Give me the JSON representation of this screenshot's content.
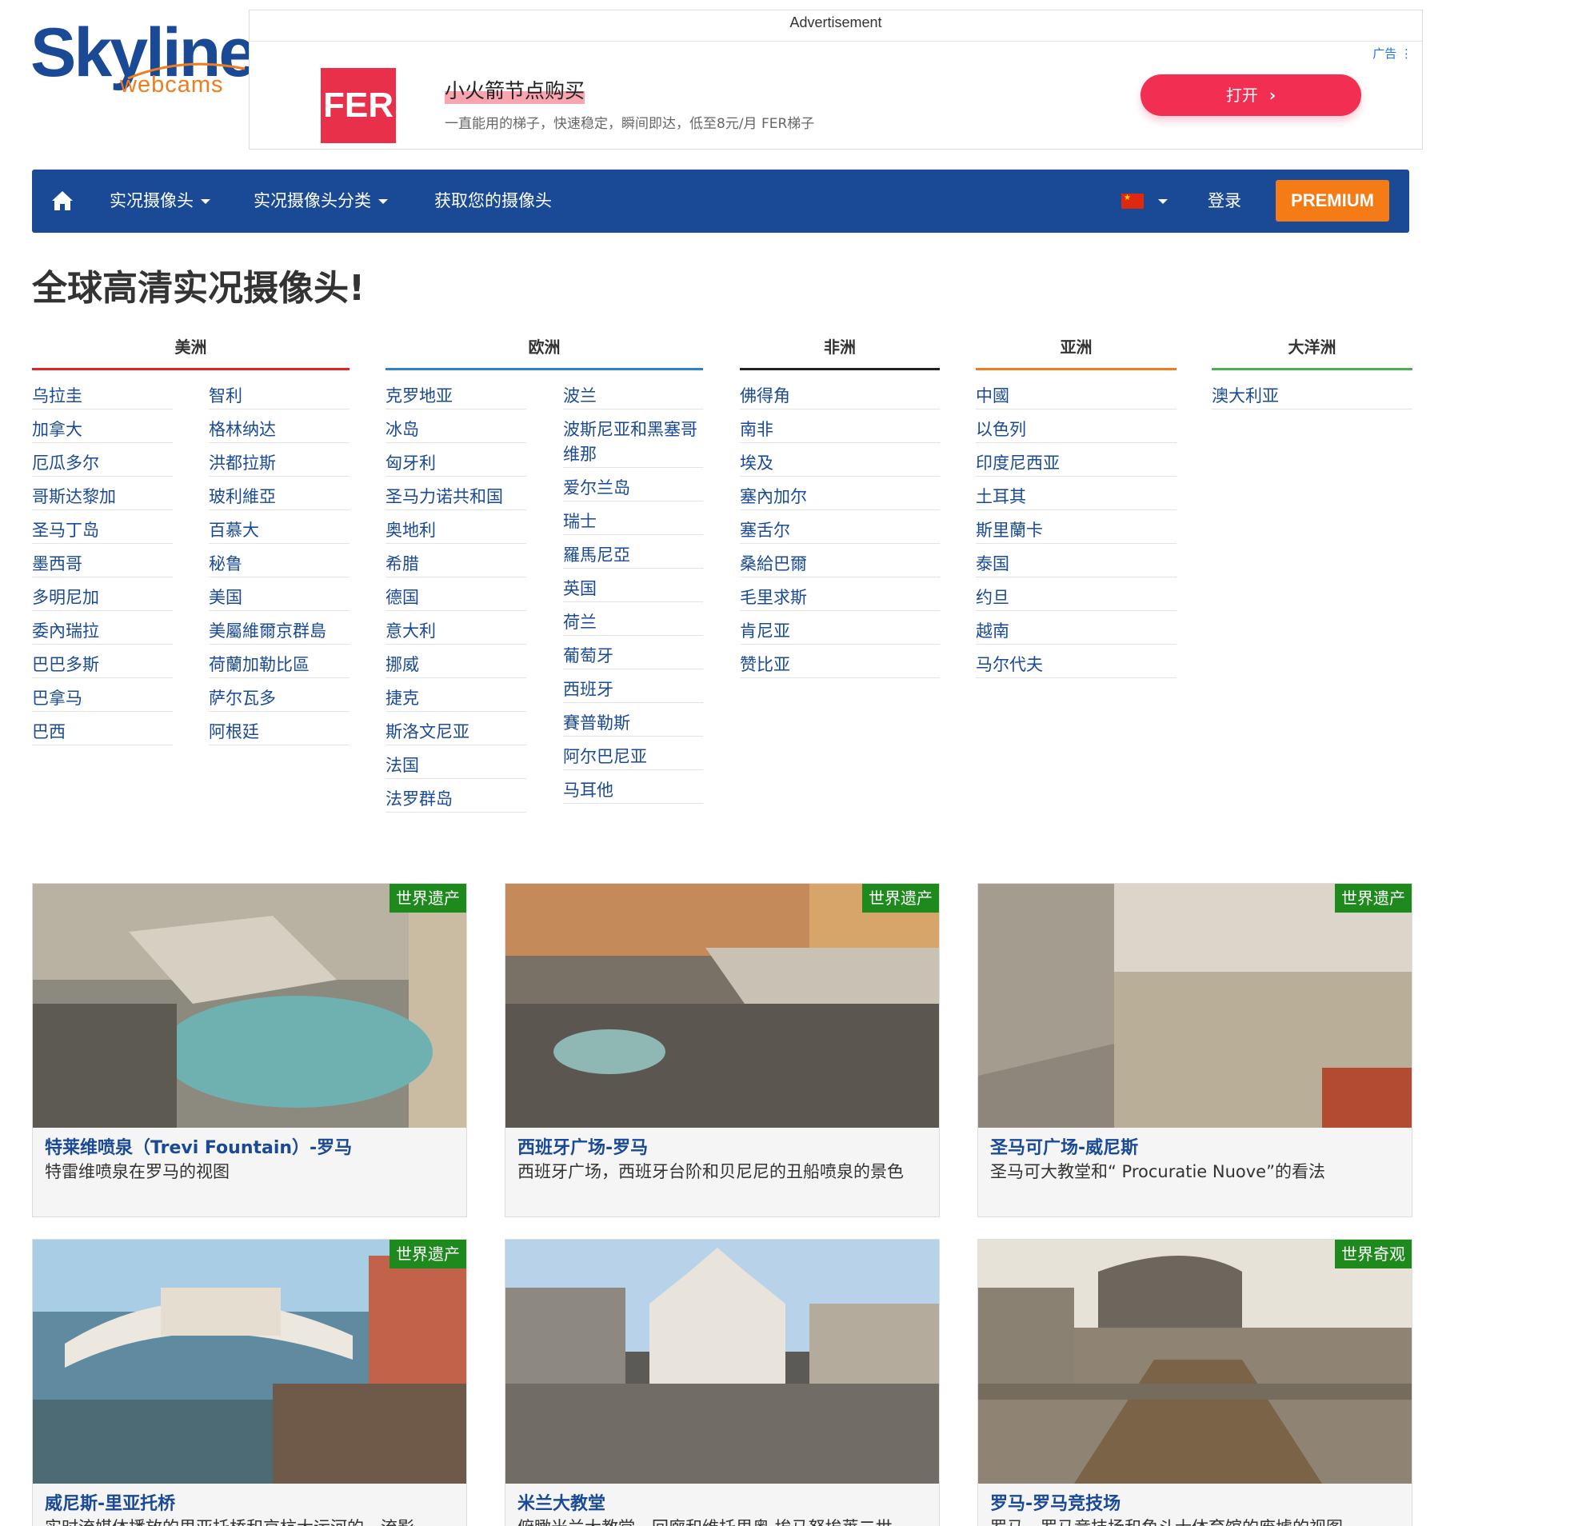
{
  "logo": {
    "main": "Skyline",
    "sub": "webcams"
  },
  "ad": {
    "label": "Advertisement",
    "brand": "FER",
    "title": "小火箭节点购买",
    "description": "一直能用的梯子，快速稳定，瞬间即达，低至8元/月 FER梯子",
    "button": "打开",
    "tag": "广告 ⋮"
  },
  "nav": {
    "home_icon": "home-icon",
    "items": [
      "实况摄像头",
      "实况摄像头分类",
      "获取您的摄像头"
    ],
    "flag_icon": "china-flag-icon",
    "login": "登录",
    "premium": "PREMIUM"
  },
  "page_title": "全球高清实况摄像头!",
  "continents": [
    {
      "name": "美洲",
      "color": "#e32424",
      "col1": [
        "乌拉圭",
        "加拿大",
        "厄瓜多尔",
        "哥斯达黎加",
        "圣马丁岛",
        "墨西哥",
        "多明尼加",
        "委內瑞拉",
        "巴巴多斯",
        "巴拿马",
        "巴西"
      ],
      "col2": [
        "智利",
        "格林纳达",
        "洪都拉斯",
        "玻利維亞",
        "百慕大",
        "秘鲁",
        "美国",
        "美屬維爾京群島",
        "荷蘭加勒比區",
        "萨尔瓦多",
        "阿根廷"
      ]
    },
    {
      "name": "欧洲",
      "color": "#2b85c8",
      "col1": [
        "克罗地亚",
        "冰岛",
        "匈牙利",
        "圣马力诺共和国",
        "奥地利",
        "希腊",
        "德国",
        "意大利",
        "挪威",
        "捷克",
        "斯洛文尼亚",
        "法国",
        "法罗群岛"
      ],
      "col2": [
        "波兰",
        "波斯尼亚和黑塞哥维那",
        "爱尔兰岛",
        "瑞士",
        "羅馬尼亞",
        "英国",
        "荷兰",
        "葡萄牙",
        "西班牙",
        "賽普勒斯",
        "阿尔巴尼亚",
        "马耳他"
      ]
    },
    {
      "name": "非洲",
      "color": "#222222",
      "col1": [
        "佛得角",
        "南非",
        "埃及",
        "塞內加尔",
        "塞舌尔",
        "桑給巴爾",
        "毛里求斯",
        "肯尼亚",
        "赞比亚"
      ]
    },
    {
      "name": "亚洲",
      "color": "#f07c1e",
      "col1": [
        "中國",
        "以色列",
        "印度尼西亚",
        "土耳其",
        "斯里蘭卡",
        "泰国",
        "约旦",
        "越南",
        "马尔代夫"
      ]
    },
    {
      "name": "大洋洲",
      "color": "#4caf50",
      "col1": [
        "澳大利亚"
      ]
    }
  ],
  "cards": [
    {
      "badge": "世界遗产",
      "title": "特莱维喷泉（Trevi Fountain）-罗马",
      "desc": "特雷维喷泉在罗马的视图"
    },
    {
      "badge": "世界遗产",
      "title": "西班牙广场-罗马",
      "desc": "西班牙广场，西班牙台阶和贝尼尼的丑船喷泉的景色"
    },
    {
      "badge": "世界遗产",
      "title": "圣马可广场-威尼斯",
      "desc": "圣马可大教堂和“ Procuratie Nuove”的看法"
    },
    {
      "badge": "世界遗产",
      "title": "威尼斯-里亚托桥",
      "desc": "实时流媒体播放的里亚托桥和京杭大运河的一流影"
    },
    {
      "badge": "",
      "title": "米兰大教堂",
      "desc": "俯瞰米兰大教堂，回廊和维托里奥·埃马努埃莱二世"
    },
    {
      "badge": "世界奇观",
      "title": "罗马-罗马竞技场",
      "desc": "罗马，罗马竞技场和角斗士体育馆的废墟的视图"
    }
  ],
  "colors": {
    "brand_blue": "#1a4a96",
    "accent_orange": "#f57b17",
    "badge_green": "#1e8a1e"
  }
}
